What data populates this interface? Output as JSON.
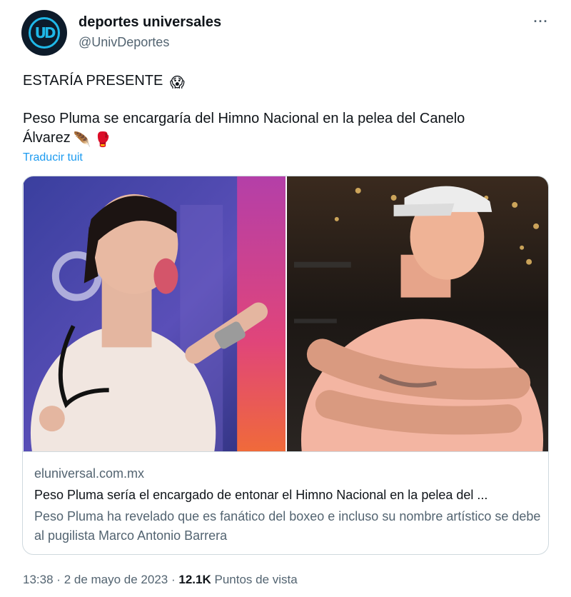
{
  "author": {
    "display_name": "deportes universales",
    "handle": "@UnivDeportes",
    "avatar_text": "UD"
  },
  "more_label": "···",
  "tweet": {
    "line1": "ESTARÍA PRESENTE",
    "line1_emoji": "😱",
    "line2": "Peso Pluma se encargaría del Himno Nacional en la pelea del Canelo",
    "line3": "Álvarez",
    "line3_emoji_1": "🪶",
    "line3_emoji_2": "🥊",
    "translate_label": "Traducir tuit"
  },
  "card": {
    "domain": "eluniversal.com.mx",
    "title": "Peso Pluma sería el encargado de entonar el Himno Nacional en la pelea del ...",
    "description": "Peso Pluma ha revelado que es fanático del boxeo e incluso su nombre artístico se debe al pugilista Marco Antonio Barrera"
  },
  "meta": {
    "time": "13:38",
    "separator": "·",
    "date": "2 de mayo de 2023",
    "views_count": "12.1K",
    "views_label": "Puntos de vista"
  },
  "colors": {
    "link": "#1d9bf0",
    "secondary_text": "#536471",
    "primary_text": "#0f1419",
    "border": "#cfd9de"
  }
}
